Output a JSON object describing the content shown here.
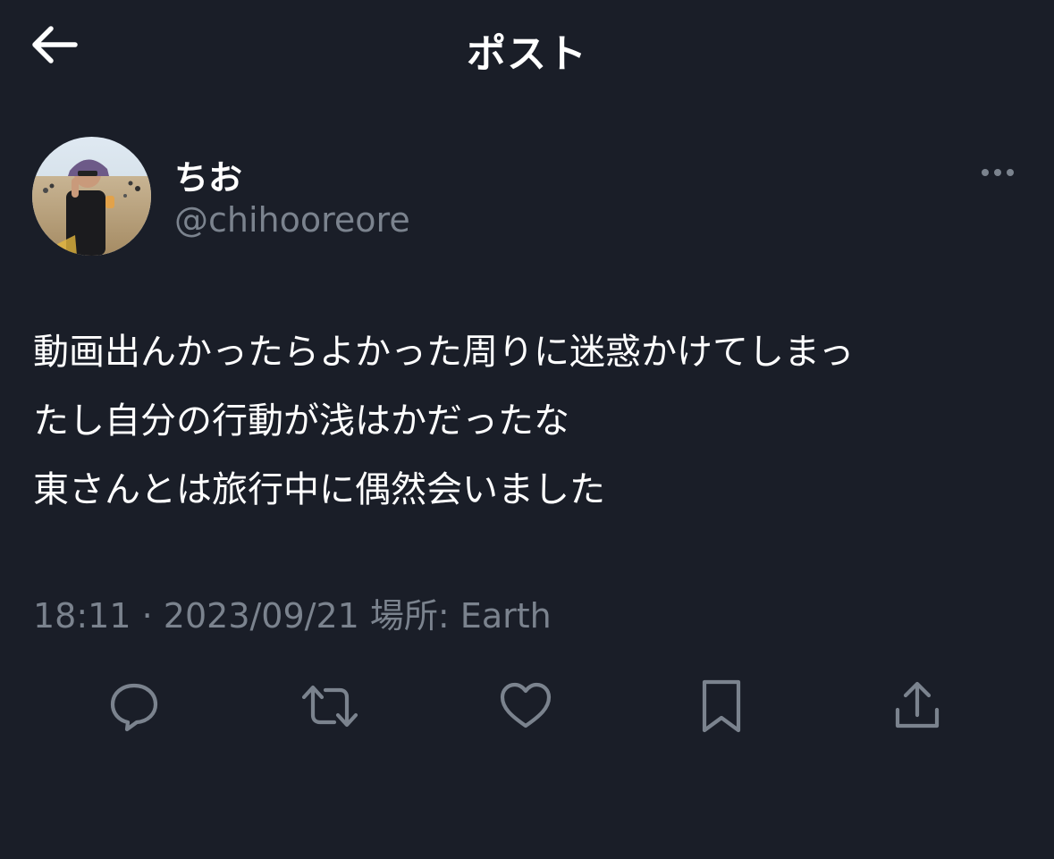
{
  "header": {
    "title": "ポスト",
    "back_icon": "arrow-left-icon"
  },
  "author": {
    "display_name": "ちお",
    "handle": "@chihooreore",
    "avatar": "user-avatar-photo"
  },
  "post": {
    "lines": [
      "動画出んかったらよかった周りに迷惑かけてしまっ",
      "たし自分の行動が浅はかだったな",
      "東さんとは旅行中に偶然会いました"
    ]
  },
  "meta": {
    "time": "18:11",
    "separator": "·",
    "date": "2023/09/21",
    "location_label": "場所: Earth"
  },
  "actions": {
    "icons": [
      "reply-icon",
      "repost-icon",
      "like-icon",
      "bookmark-icon",
      "share-icon"
    ]
  },
  "colors": {
    "background": "#1a1e28",
    "primary_text": "#ffffff",
    "secondary_text": "#7b838e",
    "icon": "#7b838e"
  }
}
